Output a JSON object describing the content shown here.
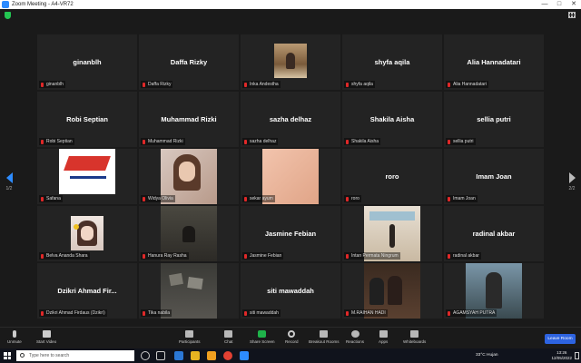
{
  "window": {
    "title": "Zoom Meeting - A4-VR72",
    "controls": [
      "—",
      "□",
      "✕"
    ]
  },
  "pager": {
    "left_page": "1/2",
    "right_page": "2/2"
  },
  "colors": {
    "accent": "#2d8cff",
    "mic_muted": "#e02828",
    "share_screen": "#1fb34a",
    "leave": "#2d63e0"
  },
  "participants": [
    {
      "display": "ginanblh",
      "label": "ginanblh",
      "video": false
    },
    {
      "display": "Daffa Rizky",
      "label": "Daffa Rizky",
      "video": false
    },
    {
      "display": "",
      "label": "Inka Andestha",
      "video": true,
      "photo": "inka"
    },
    {
      "display": "shyfa aqila",
      "label": "shyfa aqila",
      "video": false
    },
    {
      "display": "Alia Hannadatari",
      "label": "Alia Hannadatari",
      "video": false
    },
    {
      "display": "Robi Septian",
      "label": "Robi Septian",
      "video": false
    },
    {
      "display": "Muhammad Rizki",
      "label": "Muhammad Rizki",
      "video": false
    },
    {
      "display": "sazha delhaz",
      "label": "sazha delhaz",
      "video": false
    },
    {
      "display": "Shakila Aisha",
      "label": "Shakila Aisha",
      "video": false
    },
    {
      "display": "sellia putri",
      "label": "sellia putri",
      "video": false
    },
    {
      "display": "",
      "label": "Safana",
      "video": true,
      "photo": "safana"
    },
    {
      "display": "",
      "label": "Widya Olivia",
      "video": true,
      "photo": "widya"
    },
    {
      "display": "",
      "label": "sekar ayum",
      "video": true,
      "photo": "sekar"
    },
    {
      "display": "roro",
      "label": "roro",
      "video": false
    },
    {
      "display": "Imam Joan",
      "label": "Imam Joan",
      "video": false
    },
    {
      "display": "",
      "label": "Belva Ananda Shara",
      "video": true,
      "photo": "belva"
    },
    {
      "display": "",
      "label": "Hanura Ray Rasha",
      "video": true,
      "photo": "hanura"
    },
    {
      "display": "Jasmine Febian",
      "label": "Jasmine Febian",
      "video": false
    },
    {
      "display": "",
      "label": "Intan Permata Ningrum",
      "video": true,
      "photo": "intan"
    },
    {
      "display": "radinal akbar",
      "label": "radinal akbar",
      "video": false
    },
    {
      "display": "Dzikri Ahmad Fir...",
      "label": "Dzikri Ahmad Firdaus (Dzikri)",
      "video": false
    },
    {
      "display": "",
      "label": "Tika nabila",
      "video": true,
      "photo": "tika"
    },
    {
      "display": "siti mawaddah",
      "label": "siti mawaddah",
      "video": false
    },
    {
      "display": "",
      "label": "M.RAIHAN HADI",
      "video": true,
      "photo": "raihan"
    },
    {
      "display": "",
      "label": "AGAMSYAH PUTRA",
      "video": true,
      "photo": "agamsyah"
    }
  ],
  "toolbar": {
    "unmute": "Unmute",
    "start_video": "Start Video",
    "participants": "Participants",
    "participants_count": "31",
    "chat": "Chat",
    "share_screen": "Share Screen",
    "record": "Record",
    "breakout_rooms": "Breakout Rooms",
    "reactions": "Reactions",
    "apps": "Apps",
    "whiteboards": "Whiteboards",
    "leave": "Leave Room"
  },
  "taskbar": {
    "search_placeholder": "Type here to search",
    "weather": "33°C  Hujan",
    "time": "13:26",
    "date": "12/05/2022"
  }
}
